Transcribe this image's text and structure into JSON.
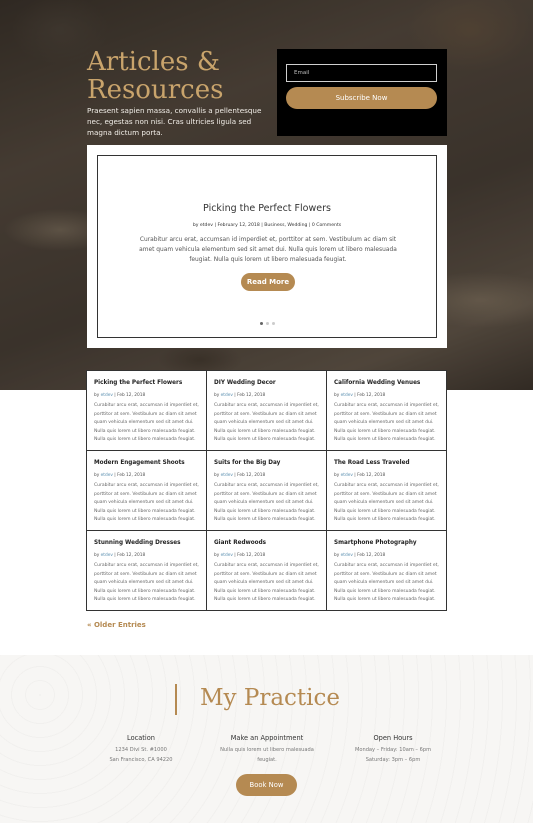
{
  "hero": {
    "title_line1": "Articles &",
    "title_line2": "Resources",
    "subtitle": "Praesent sapien massa, convallis a pellentesque nec, egestas non nisi. Cras ultricies ligula sed magna dictum porta."
  },
  "subscribe": {
    "email_placeholder": "Email",
    "button_label": "Subscribe Now"
  },
  "slider": {
    "title": "Picking the Perfect Flowers",
    "meta": "by etdev | February 12, 2018 | Business, Wedding | 0 Comments",
    "excerpt": "Curabitur arcu erat, accumsan id imperdiet et, porttitor at sem. Vestibulum ac diam sit amet quam vehicula elementum sed sit amet dui. Nulla quis lorem ut libero malesuada feugiat. Nulla quis lorem ut libero malesuada feugiat.",
    "button_label": "Read More",
    "dots": 3,
    "active_dot": 1
  },
  "posts": [
    {
      "title": "Picking the Perfect Flowers",
      "author": "etdev",
      "date": "Feb 12, 2018"
    },
    {
      "title": "DIY Wedding Decor",
      "author": "etdev",
      "date": "Feb 12, 2018"
    },
    {
      "title": "California Wedding Venues",
      "author": "etdev",
      "date": "Feb 12, 2018"
    },
    {
      "title": "Modern Engagement Shoots",
      "author": "etdev",
      "date": "Feb 12, 2018"
    },
    {
      "title": "Suits for the Big Day",
      "author": "etdev",
      "date": "Feb 12, 2018"
    },
    {
      "title": "The Road Less Traveled",
      "author": "etdev",
      "date": "Feb 12, 2018"
    },
    {
      "title": "Stunning Wedding Dresses",
      "author": "etdev",
      "date": "Feb 12, 2018"
    },
    {
      "title": "Giant Redwoods",
      "author": "etdev",
      "date": "Feb 12, 2018"
    },
    {
      "title": "Smartphone Photography",
      "author": "etdev",
      "date": "Feb 12, 2018"
    }
  ],
  "post_excerpt": "Curabitur arcu erat, accumsan id imperdiet et, porttitor at sem. Vestibulum ac diam sit amet quam vehicula elementum sed sit amet dui. Nulla quis lorem ut libero malesuada feugiat. Nulla quis lorem ut libero malesuada feugiat.",
  "pagination": {
    "older_label": "« Older Entries"
  },
  "practice": {
    "title": "My Practice",
    "columns": [
      {
        "heading": "Location",
        "line1": "1234 Divi St. #1000",
        "line2": "San Francisco, CA 94220"
      },
      {
        "heading": "Make an Appointment",
        "line1": "Nulla quis lorem ut libero malesuada",
        "line2": "feugiat."
      },
      {
        "heading": "Open Hours",
        "line1": "Monday – Friday: 10am – 6pm",
        "line2": "Saturday: 3pm – 6pm"
      }
    ],
    "button_label": "Book Now"
  },
  "colors": {
    "accent": "#b58a52",
    "dark": "#000000",
    "link": "#5a8fb0"
  }
}
